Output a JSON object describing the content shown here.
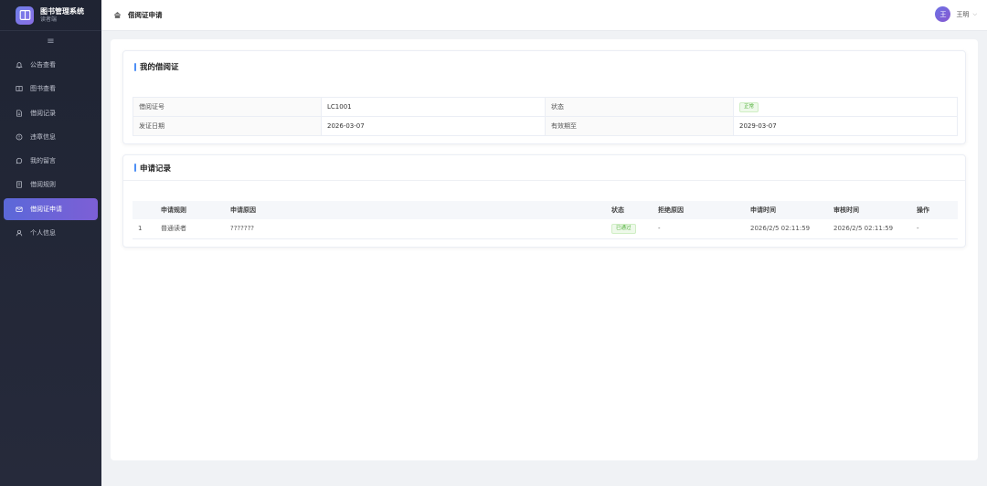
{
  "app": {
    "title": "图书管理系统",
    "subtitle": "读者端"
  },
  "sidebar": {
    "collapse_icon": "≡",
    "items": [
      {
        "label": "公告查看",
        "icon": "bell-icon"
      },
      {
        "label": "图书查看",
        "icon": "book-icon"
      },
      {
        "label": "借阅记录",
        "icon": "document-icon"
      },
      {
        "label": "违章信息",
        "icon": "info-circle-icon"
      },
      {
        "label": "我的留言",
        "icon": "chat-icon"
      },
      {
        "label": "借阅规则",
        "icon": "notebook-icon"
      },
      {
        "label": "借阅证申请",
        "icon": "card-icon",
        "active": true
      },
      {
        "label": "个人信息",
        "icon": "user-icon"
      }
    ]
  },
  "header": {
    "breadcrumb": "借阅证申请",
    "user": {
      "avatar": "王",
      "name": "王明"
    }
  },
  "card_info": {
    "title": "我的借阅证",
    "rows": [
      {
        "l1": "借阅证号",
        "v1": "LC1001",
        "l2": "状态",
        "v2": "正常"
      },
      {
        "l1": "发证日期",
        "v1": "2026-03-07",
        "l2": "有效期至",
        "v2": "2029-03-07"
      }
    ]
  },
  "records": {
    "title": "申请记录",
    "columns": [
      "",
      "申请规则",
      "申请原因",
      "状态",
      "拒绝原因",
      "申请时间",
      "审核时间",
      "操作"
    ],
    "rows": [
      {
        "idx": "1",
        "rule": "普通读者",
        "reason": "???????",
        "status": "已通过",
        "reject": "-",
        "apply_time": "2026/2/5 02:11:59",
        "review_time": "2026/2/5 02:11:59",
        "op": "-"
      }
    ]
  },
  "colors": {
    "accent": "#5b68d8",
    "sidebar_bg": "#1f2433",
    "success": "#52b03c",
    "title_bar": "#4e8ff5"
  }
}
